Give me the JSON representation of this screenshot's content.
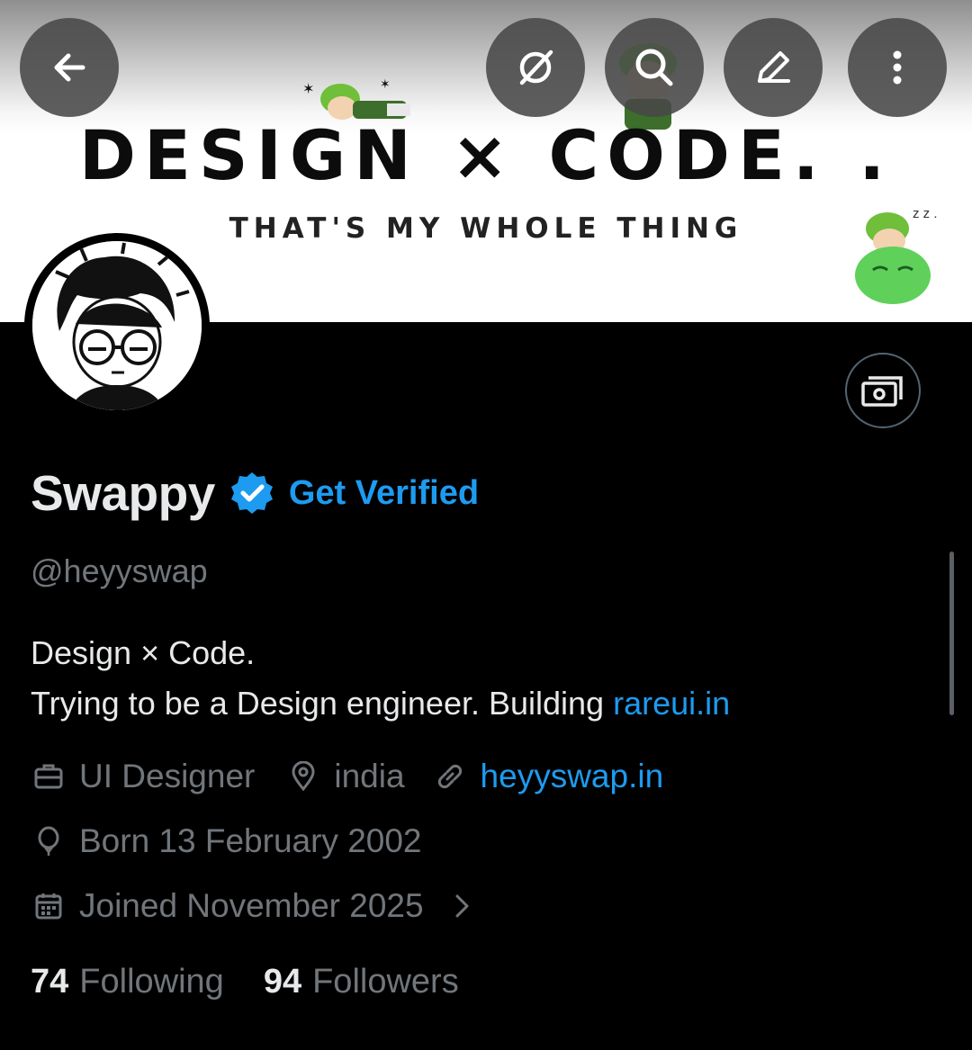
{
  "banner": {
    "title": "DESIGN × CODE. .",
    "subtitle": "THAT'S MY WHOLE THING"
  },
  "toolbar": {
    "back_icon": "arrow-left-icon",
    "grok_icon": "grok-icon",
    "search_icon": "search-icon",
    "edit_icon": "pencil-icon",
    "more_icon": "more-vertical-icon"
  },
  "profile": {
    "name": "Swappy",
    "get_verified_label": "Get Verified",
    "handle": "@heyyswap",
    "bio_line1": "Design × Code.",
    "bio_line2_prefix": "Trying to be a Design engineer. Building ",
    "bio_link": "rareui.in",
    "profession": "UI Designer",
    "location": "india",
    "website": "heyyswap.in",
    "birthday": "Born 13 February 2002",
    "joined": "Joined November 2025",
    "following_count": "74",
    "following_label": "Following",
    "followers_count": "94",
    "followers_label": "Followers"
  },
  "colors": {
    "background": "#000000",
    "text_primary": "#e7e9ea",
    "text_secondary": "#71767b",
    "accent": "#1d9bf0"
  }
}
